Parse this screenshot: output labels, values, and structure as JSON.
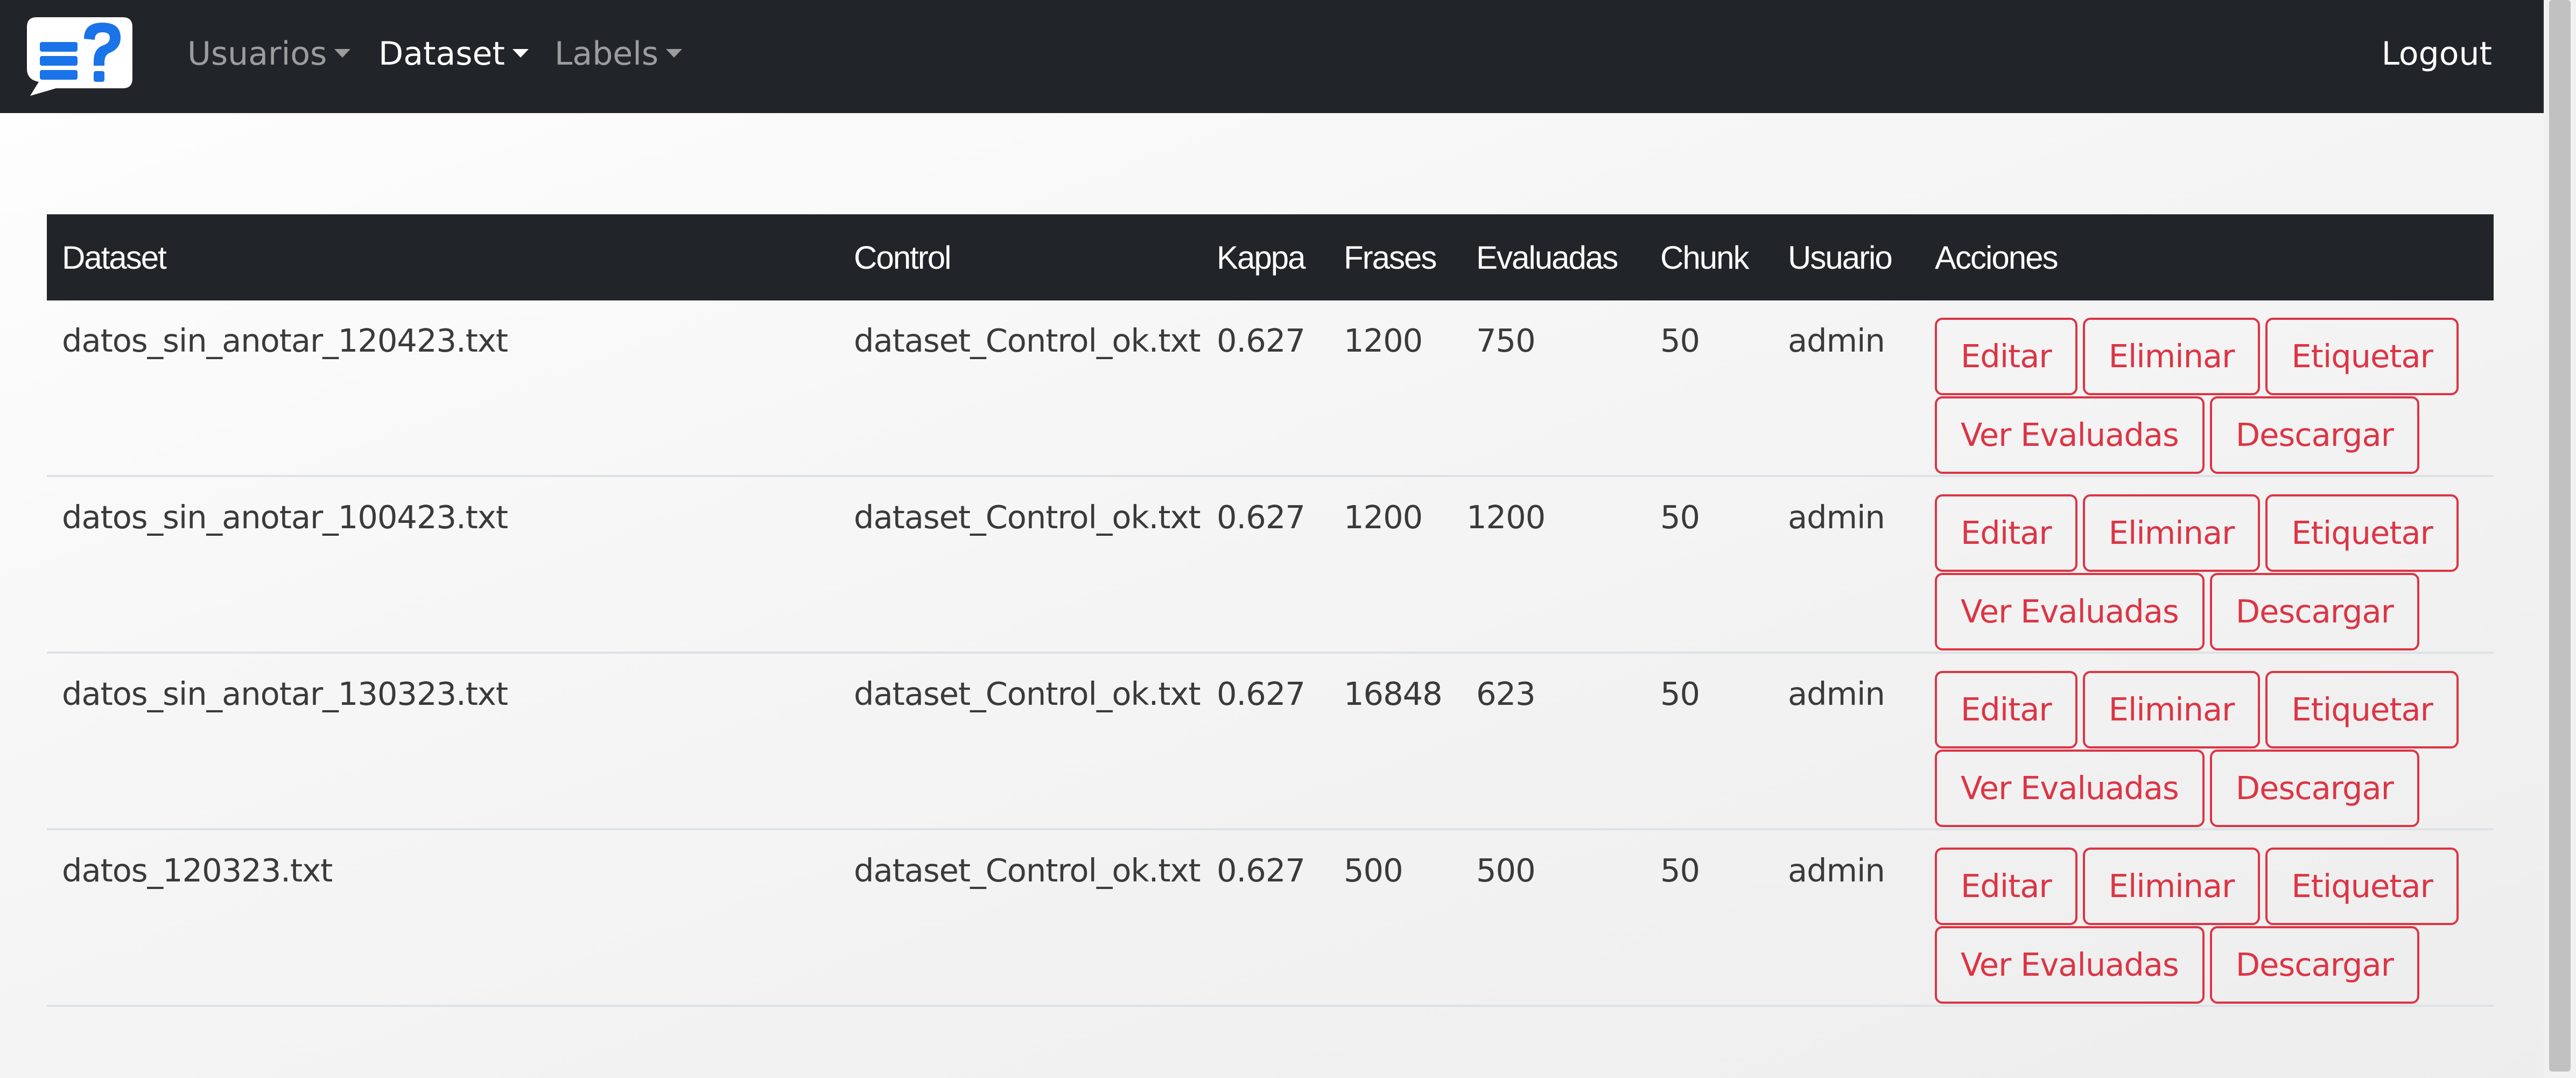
{
  "nav": {
    "brand_icon": "chat-question-list-icon",
    "items": [
      {
        "label": "Usuarios",
        "active": false
      },
      {
        "label": "Dataset",
        "active": true
      },
      {
        "label": "Labels",
        "active": false
      }
    ],
    "logout_label": "Logout"
  },
  "colors": {
    "navbar_bg": "#212529",
    "brand_blue": "#1a73e8",
    "danger": "#dc3545"
  },
  "table": {
    "headers": {
      "dataset": "Dataset",
      "control": "Control",
      "kappa": "Kappa",
      "frases": "Frases",
      "evaluadas": "Evaluadas",
      "chunk": "Chunk",
      "usuario": "Usuario",
      "acciones": "Acciones"
    },
    "actions": {
      "editar": "Editar",
      "eliminar": "Eliminar",
      "etiquetar": "Etiquetar",
      "ver_evaluadas": "Ver Evaluadas",
      "descargar": "Descargar"
    },
    "rows": [
      {
        "dataset": "datos_sin_anotar_120423.txt",
        "control": "dataset_Control_ok.txt",
        "kappa": "0.627",
        "frases": "1200",
        "evaluadas": "750",
        "chunk": "50",
        "usuario": "admin"
      },
      {
        "dataset": "datos_sin_anotar_100423.txt",
        "control": "dataset_Control_ok.txt",
        "kappa": "0.627",
        "frases": "1200",
        "evaluadas": "1200",
        "chunk": "50",
        "usuario": "admin"
      },
      {
        "dataset": "datos_sin_anotar_130323.txt",
        "control": "dataset_Control_ok.txt",
        "kappa": "0.627",
        "frases": "16848",
        "evaluadas": "623",
        "chunk": "50",
        "usuario": "admin"
      },
      {
        "dataset": "datos_120323.txt",
        "control": "dataset_Control_ok.txt",
        "kappa": "0.627",
        "frases": "500",
        "evaluadas": "500",
        "chunk": "50",
        "usuario": "admin"
      }
    ]
  }
}
